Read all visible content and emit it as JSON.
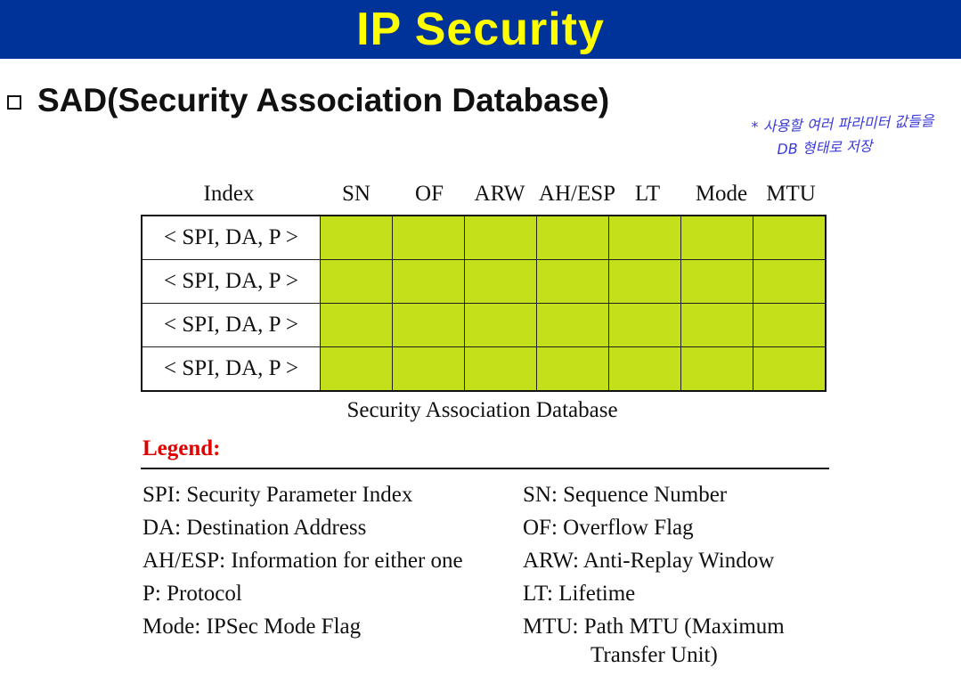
{
  "slide": {
    "title": "IP Security",
    "heading": "SAD(Security Association Database)",
    "annotation": {
      "line1": "* 사용할 여러 파라미터 값들을",
      "line2": "DB 형태로 저장"
    }
  },
  "table": {
    "columns": [
      "Index",
      "SN",
      "OF",
      "ARW",
      "AH/ESP",
      "LT",
      "Mode",
      "MTU"
    ],
    "rows": [
      "< SPI, DA, P >",
      "< SPI, DA, P >",
      "< SPI, DA, P >",
      "< SPI, DA, P >"
    ],
    "caption": "Security Association Database",
    "cell_color": "#c3e01a"
  },
  "legend": {
    "title": "Legend:",
    "left": [
      "SPI: Security Parameter Index",
      "DA: Destination Address",
      "AH/ESP: Information for either one",
      "P: Protocol",
      "Mode: IPSec Mode Flag"
    ],
    "right": [
      "SN: Sequence Number",
      "OF: Overflow Flag",
      "ARW: Anti-Replay Window",
      "LT: Lifetime",
      "MTU: Path MTU (Maximum"
    ],
    "right_continuation": "Transfer Unit)"
  },
  "colors": {
    "title_bar": "#003399",
    "title_text": "#ffff00",
    "legend_title": "#e00000",
    "annotation": "#3a3ad8"
  }
}
